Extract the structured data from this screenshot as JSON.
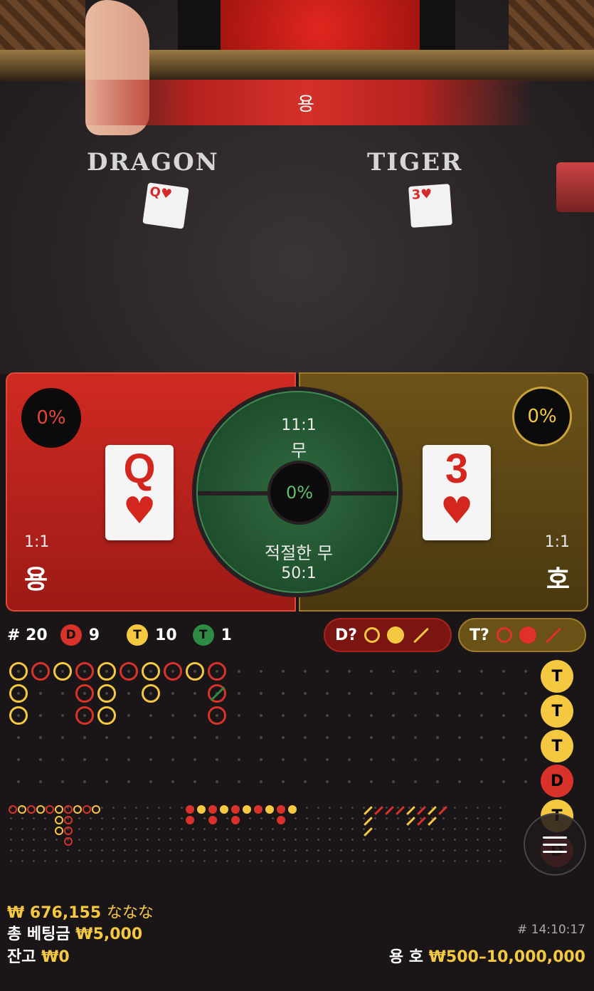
{
  "video": {
    "banner_text": "용",
    "dragon_label": "DRAGON",
    "tiger_label": "TIGER",
    "dragon_card": {
      "rank": "Q",
      "suit": "♥"
    },
    "tiger_card": {
      "rank": "3",
      "suit": "♥"
    }
  },
  "dragon": {
    "percent": "0%",
    "rank": "Q",
    "suit": "♥",
    "odds": "1:1",
    "name": "용",
    "color": "#cf2a22"
  },
  "tiger": {
    "percent": "0%",
    "rank": "3",
    "suit": "♥",
    "odds": "1:1",
    "name": "호",
    "color": "#6c5318"
  },
  "tie": {
    "odds": "11:1",
    "label": "무",
    "percent": "0%",
    "suited_label": "적절한 무",
    "suited_odds": "50:1"
  },
  "stats": {
    "round": "# 20",
    "dragon_badge": "D",
    "dragon_count": "9",
    "tiger_badge": "T",
    "tiger_count": "10",
    "tie_badge": "T",
    "tie_count": "1"
  },
  "predict": {
    "dragon_label": "D?",
    "tiger_label": "T?"
  },
  "history_beads": [
    "T",
    "T",
    "T",
    "D",
    "T",
    "D"
  ],
  "footer": {
    "win_amount": "₩ 676,155",
    "win_suffix": "ななな",
    "total_bet_label": "총 베팅금",
    "total_bet": "₩5,000",
    "balance_label": "잔고",
    "balance": "₩0",
    "time": "# 14:10:17",
    "limit_label": "용 호",
    "limit": "₩500–10,000,000"
  },
  "colors": {
    "red": "#d8322a",
    "gold": "#f5c842",
    "green": "#2f8a44"
  },
  "icons": {
    "menu": "hamburger-menu-icon"
  }
}
